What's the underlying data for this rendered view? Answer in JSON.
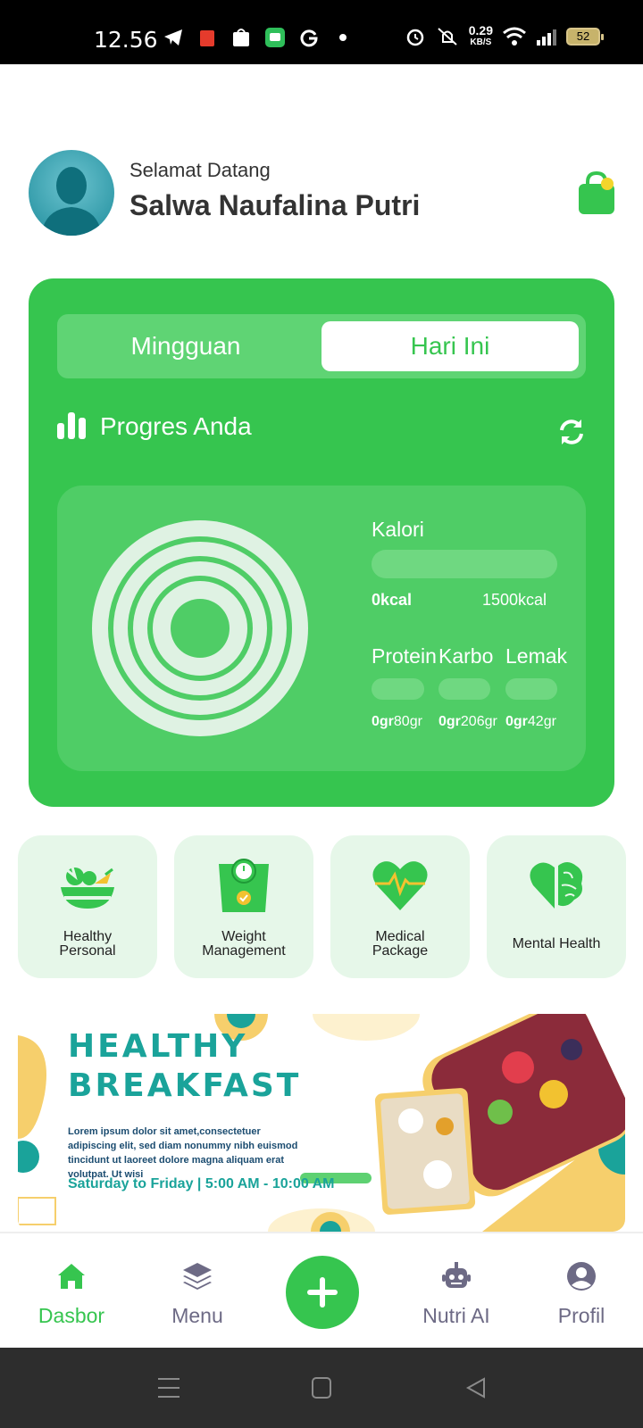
{
  "status_bar": {
    "time": "12.56",
    "network_speed": "0.29",
    "network_unit": "KB/S",
    "battery": "52"
  },
  "header": {
    "greeting": "Selamat Datang",
    "user_name": "Salwa Naufalina Putri"
  },
  "progress_card": {
    "tabs": [
      {
        "label": "Mingguan",
        "selected": false
      },
      {
        "label": "Hari Ini",
        "selected": true
      }
    ],
    "title": "Progres Anda",
    "calories": {
      "label": "Kalori",
      "current": "0kcal",
      "target": "1500kcal"
    },
    "macros": [
      {
        "label": "Protein",
        "current": "0gr",
        "target": "80gr"
      },
      {
        "label": "Karbo",
        "current": "0gr",
        "target": "206gr"
      },
      {
        "label": "Lemak",
        "current": "0gr",
        "target": "42gr"
      }
    ]
  },
  "categories": [
    {
      "line1": "Healthy",
      "line2": "Personal",
      "icon": "salad-bowl-icon"
    },
    {
      "line1": "Weight",
      "line2": "Management",
      "icon": "weight-scale-icon"
    },
    {
      "line1": "Medical",
      "line2": "Package",
      "icon": "heart-pulse-icon"
    },
    {
      "line1": "Mental Health",
      "line2": "",
      "icon": "brain-heart-icon"
    }
  ],
  "banner": {
    "title_line1": "HEALTHY",
    "title_line2": "BREAKFAST",
    "body": "Lorem ipsum dolor sit amet,consectetuer adipiscing elit, sed diam nonummy nibh euismod tincidunt ut laoreet dolore magna aliquam erat volutpat. Ut wisi",
    "schedule": "Saturday to Friday | 5:00 AM - 10:00 AM"
  },
  "bottom_nav": [
    {
      "label": "Dasbor",
      "icon": "home-icon",
      "active": true
    },
    {
      "label": "Menu",
      "icon": "layers-icon",
      "active": false
    },
    {
      "label": "Nutri AI",
      "icon": "robot-icon",
      "active": false
    },
    {
      "label": "Profil",
      "icon": "user-circle-icon",
      "active": false
    }
  ],
  "colors": {
    "primary": "#36c54f",
    "tile_bg": "#e6f7e9",
    "nav_inactive": "#6d6a85",
    "banner_teal": "#1aa39a"
  }
}
